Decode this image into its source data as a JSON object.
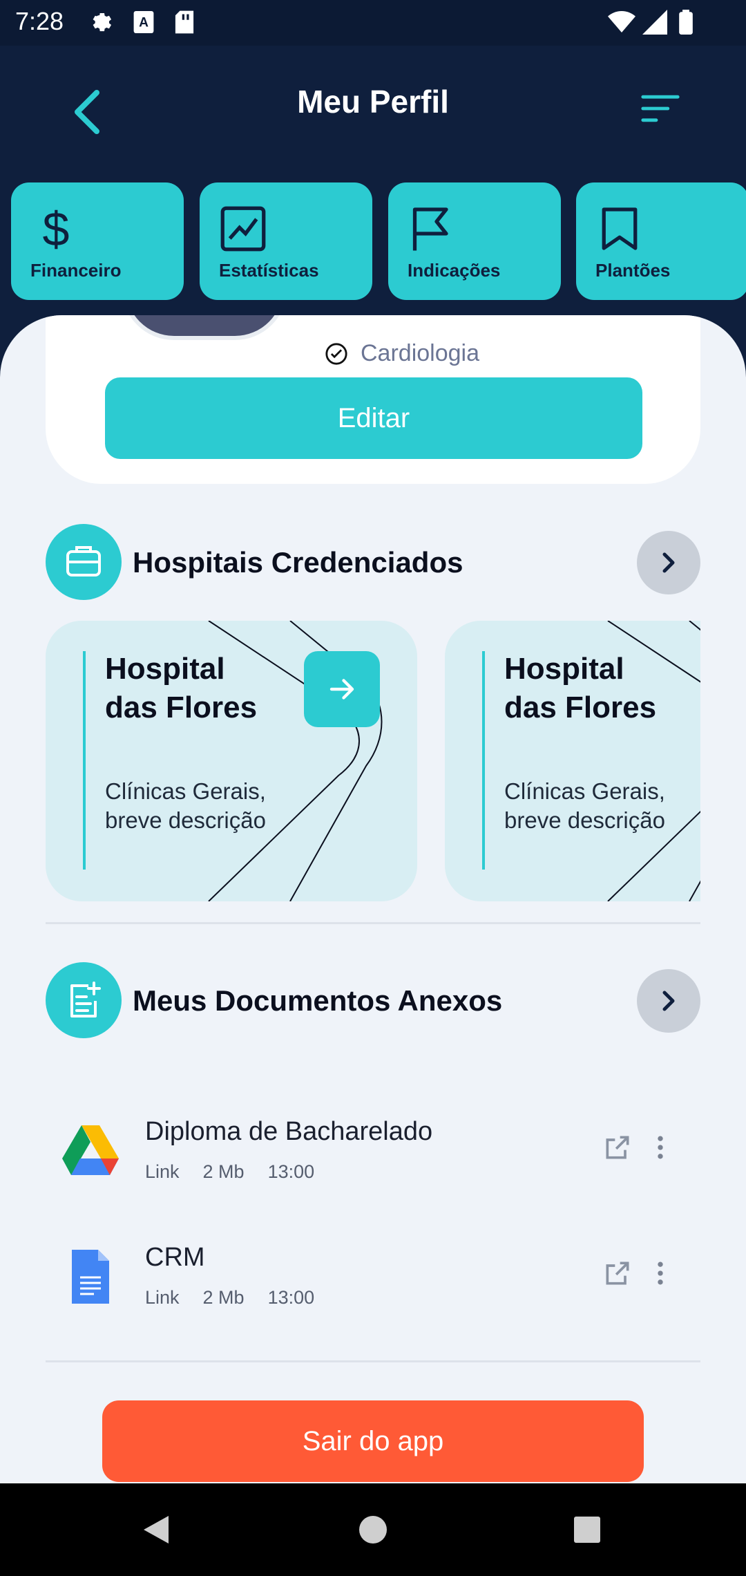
{
  "status_bar": {
    "time": "7:28"
  },
  "header": {
    "title": "Meu Perfil"
  },
  "tabs": [
    {
      "label": "Financeiro",
      "icon": "dollar-icon"
    },
    {
      "label": "Estatísticas",
      "icon": "chart-icon"
    },
    {
      "label": "Indicações",
      "icon": "flag-icon"
    },
    {
      "label": "Plantões",
      "icon": "bookmark-icon"
    }
  ],
  "profile": {
    "specialty": "Cardiologia",
    "edit_label": "Editar"
  },
  "hospitals": {
    "title": "Hospitais Credenciados",
    "items": [
      {
        "name": "Hospital das Flores",
        "description": "Clínicas Gerais, breve descrição"
      },
      {
        "name": "Hospital das Flores",
        "description": "Clínicas Gerais, breve descrição"
      }
    ]
  },
  "documents": {
    "title": "Meus Documentos Anexos",
    "items": [
      {
        "name": "Diploma de Bacharelado",
        "type": "Link",
        "size": "2 Mb",
        "time": "13:00",
        "icon": "google-drive-icon"
      },
      {
        "name": "CRM",
        "type": "Link",
        "size": "2 Mb",
        "time": "13:00",
        "icon": "google-docs-icon"
      }
    ]
  },
  "logout_label": "Sair do app",
  "colors": {
    "accent": "#2ccbd1",
    "header_bg": "#0f1f3d",
    "danger": "#ff5a36",
    "sheet_bg": "#eff3f9"
  }
}
